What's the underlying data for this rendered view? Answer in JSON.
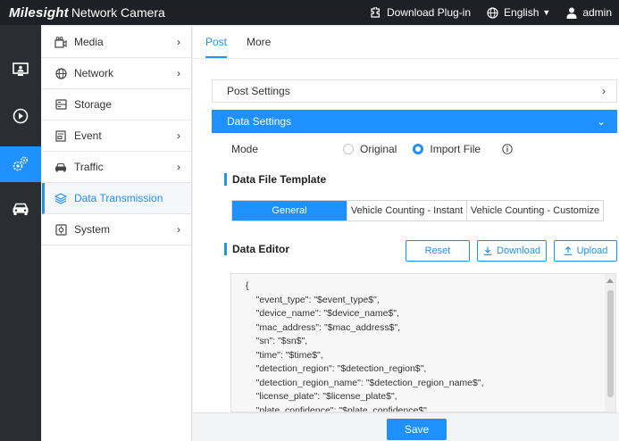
{
  "header": {
    "brand_logo": "Milesight",
    "brand_product": "Network Camera",
    "download_plugin": "Download Plug-in",
    "language": "English",
    "user": "admin"
  },
  "rail": {
    "items": [
      {
        "icon": "monitor-icon",
        "active": false
      },
      {
        "icon": "play-icon",
        "active": false
      },
      {
        "icon": "gears-icon",
        "active": true
      },
      {
        "icon": "car-icon",
        "active": false
      }
    ]
  },
  "menu": {
    "items": [
      {
        "label": "Media",
        "icon": "media-icon",
        "has_arrow": true
      },
      {
        "label": "Network",
        "icon": "globe-icon",
        "has_arrow": true
      },
      {
        "label": "Storage",
        "icon": "storage-icon",
        "has_arrow": false
      },
      {
        "label": "Event",
        "icon": "event-icon",
        "has_arrow": true
      },
      {
        "label": "Traffic",
        "icon": "car-icon",
        "has_arrow": true
      },
      {
        "label": "Data Transmission",
        "icon": "layers-icon",
        "has_arrow": false,
        "active": true
      },
      {
        "label": "System",
        "icon": "system-icon",
        "has_arrow": true
      }
    ]
  },
  "tabs": [
    {
      "label": "Post",
      "active": true
    },
    {
      "label": "More",
      "active": false
    }
  ],
  "post_settings": {
    "label": "Post Settings"
  },
  "data_settings": {
    "label": "Data Settings",
    "mode_label": "Mode",
    "mode_options": [
      {
        "label": "Original",
        "checked": false
      },
      {
        "label": "Import File",
        "checked": true
      }
    ],
    "template_title": "Data File Template",
    "template_options": [
      {
        "label": "General",
        "active": true
      },
      {
        "label": "Vehicle Counting - Instant",
        "active": false
      },
      {
        "label": "Vehicle Counting - Customize",
        "active": false
      }
    ],
    "editor_title": "Data Editor",
    "reset_label": "Reset",
    "download_label": "Download",
    "upload_label": "Upload",
    "code_lines": [
      "{",
      "    \"event_type\": \"$event_type$\",",
      "    \"device_name\": \"$device_name$\",",
      "    \"mac_address\": \"$mac_address$\",",
      "    \"sn\": \"$sn$\",",
      "    \"time\": \"$time$\",",
      "    \"detection_region\": \"$detection_region$\",",
      "    \"detection_region_name\": \"$detection_region_name$\",",
      "    \"license_plate\": \"$license_plate$\",",
      "    \"plate_confidence\": \"$plate_confidence$\","
    ]
  },
  "footer": {
    "save_label": "Save"
  },
  "colors": {
    "accent": "#1e90ff",
    "topbar": "#1d2024",
    "rail": "#2a2e33"
  }
}
